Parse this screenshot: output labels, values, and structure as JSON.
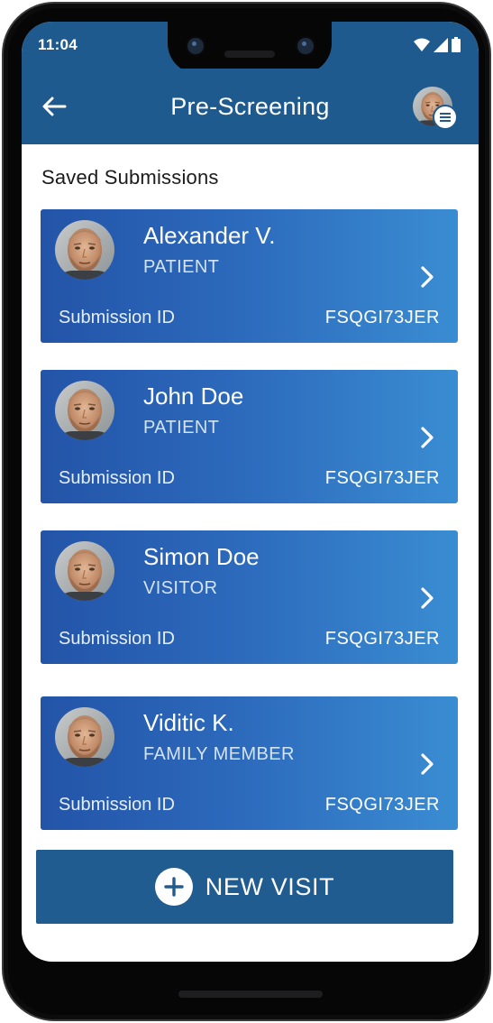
{
  "status_bar": {
    "time": "11:04"
  },
  "app_bar": {
    "title": "Pre-Screening"
  },
  "section": {
    "title": "Saved Submissions"
  },
  "submissions": [
    {
      "name": "Alexander V.",
      "role": "PATIENT",
      "id_label": "Submission ID",
      "id_value": "FSQGI73JER"
    },
    {
      "name": "John Doe",
      "role": "PATIENT",
      "id_label": "Submission ID",
      "id_value": "FSQGI73JER"
    },
    {
      "name": "Simon Doe",
      "role": "VISITOR",
      "id_label": "Submission ID",
      "id_value": "FSQGI73JER"
    },
    {
      "name": "Viditic K.",
      "role": "FAMILY MEMBER",
      "id_label": "Submission ID",
      "id_value": "FSQGI73JER"
    }
  ],
  "new_visit": {
    "label": "NEW VISIT"
  },
  "icons": {
    "back": "arrow-left-icon",
    "menu": "menu-icon",
    "chevron": "chevron-right-icon",
    "plus": "plus-icon",
    "wifi": "wifi-icon",
    "signal": "signal-icon",
    "battery": "battery-icon"
  },
  "colors": {
    "primary": "#1f5a8e",
    "card_gradient_start": "#2354a8",
    "card_gradient_end": "#3a8dd2",
    "button": "#215c91"
  }
}
